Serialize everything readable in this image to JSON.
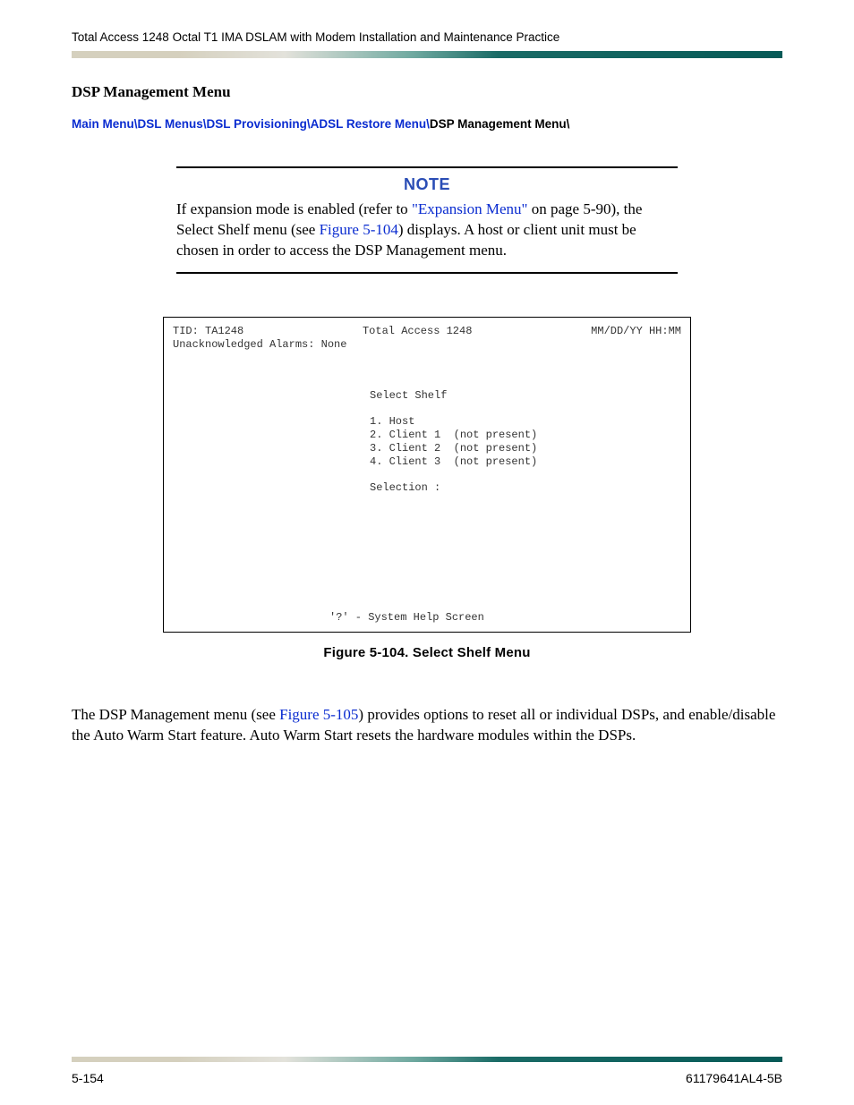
{
  "header": "Total Access 1248 Octal T1 IMA DSLAM with Modem Installation and Maintenance Practice",
  "section_heading": "DSP Management Menu",
  "breadcrumb": {
    "items": [
      {
        "label": "Main Menu",
        "link": true
      },
      {
        "label": "DSL Menus",
        "link": true
      },
      {
        "label": "DSL Provisioning",
        "link": true
      },
      {
        "label": "ADSL Restore Menu",
        "link": true
      }
    ],
    "current": "DSP Management Menu"
  },
  "note": {
    "label": "NOTE",
    "pre1": "If expansion mode is enabled (refer to ",
    "ref1": "\"Expansion Menu\"",
    "mid1": " on page 5-90), the Select Shelf menu (see ",
    "ref2": "Figure 5-104",
    "post1": ") displays. A host or client unit must be chosen in order to access the DSP Management menu."
  },
  "terminal": {
    "tid": "TID: TA1248",
    "product": "Total Access 1248",
    "datetime": "MM/DD/YY  HH:MM",
    "alarms": "Unacknowledged Alarms: None",
    "title": "Select Shelf",
    "items": [
      "1. Host",
      "2. Client 1  (not present)",
      "3. Client 2  (not present)",
      "4. Client 3  (not present)"
    ],
    "selection": "Selection :",
    "help": "'?' - System Help Screen"
  },
  "figure_caption": "Figure 5-104.  Select Shelf Menu",
  "body": {
    "pre": "The DSP Management menu (see ",
    "ref": "Figure 5-105",
    "post": ") provides options to reset all or individual DSPs, and enable/disable the Auto Warm Start feature. Auto Warm Start resets the hardware modules within the DSPs."
  },
  "footer": {
    "left": "5-154",
    "right": "61179641AL4-5B"
  }
}
